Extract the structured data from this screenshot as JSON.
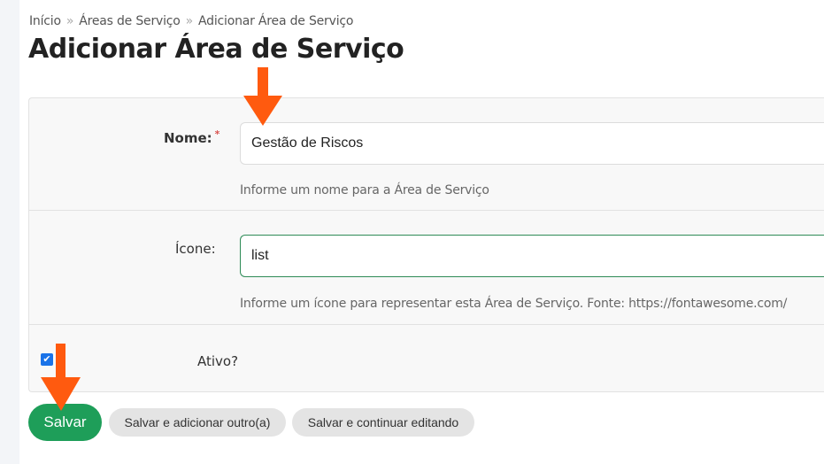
{
  "breadcrumb": {
    "home": "Início",
    "section": "Áreas de Serviço",
    "current": "Adicionar Área de Serviço",
    "separator": "»"
  },
  "page_title": "Adicionar Área de Serviço",
  "form": {
    "name": {
      "label": "Nome:",
      "required_mark": "*",
      "value": "Gestão de Riscos",
      "help": "Informe um nome para a Área de Serviço"
    },
    "icon": {
      "label": "Ícone:",
      "value": "list",
      "help": "Informe um ícone para representar esta Área de Serviço. Fonte: https://fontawesome.com/"
    },
    "active": {
      "label": "Ativo?",
      "checked": true
    }
  },
  "buttons": {
    "save": "Salvar",
    "save_add": "Salvar e adicionar outro(a)",
    "save_continue": "Salvar e continuar editando"
  },
  "colors": {
    "accent": "#1e9e59",
    "annotation_arrow": "#ff5a0f",
    "checkbox": "#1a73e8"
  }
}
